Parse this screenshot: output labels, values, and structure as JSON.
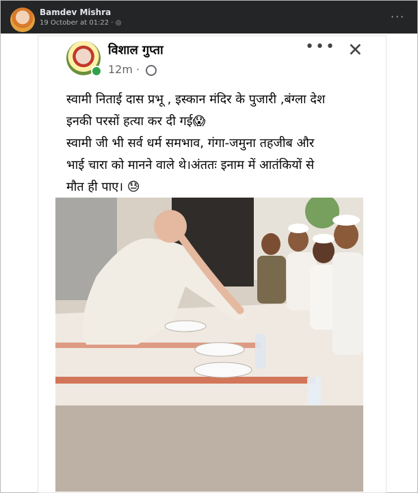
{
  "outer_post": {
    "author": "Bamdev Mishra",
    "timestamp": "19 October at 01:22 ·",
    "more_label": "···"
  },
  "inner_post": {
    "author": "विशाल गुप्ता",
    "time": "12m ·",
    "more_label": "•••",
    "close_label": "✕",
    "lines": [
      "स्वामी निताई दास प्रभू , इस्कान मंदिर के पुजारी ,बंग्ला देश",
      "इनकी परसों हत्या कर दी गई😱",
      "स्वामी जी भी सर्व धर्म समभाव, गंगा-जमुना तहजीब और",
      "भाई चारा को मानने वाले थे।अंततः इनाम में आतंकियों से",
      "मौत ही पाए। 😓"
    ]
  }
}
